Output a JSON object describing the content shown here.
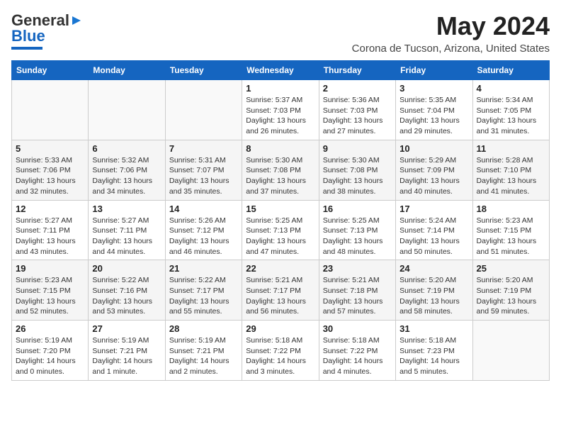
{
  "logo": {
    "line1": "General",
    "line2": "Blue"
  },
  "title": "May 2024",
  "location": "Corona de Tucson, Arizona, United States",
  "days_header": [
    "Sunday",
    "Monday",
    "Tuesday",
    "Wednesday",
    "Thursday",
    "Friday",
    "Saturday"
  ],
  "weeks": [
    [
      {
        "day": "",
        "info": ""
      },
      {
        "day": "",
        "info": ""
      },
      {
        "day": "",
        "info": ""
      },
      {
        "day": "1",
        "info": "Sunrise: 5:37 AM\nSunset: 7:03 PM\nDaylight: 13 hours\nand 26 minutes."
      },
      {
        "day": "2",
        "info": "Sunrise: 5:36 AM\nSunset: 7:03 PM\nDaylight: 13 hours\nand 27 minutes."
      },
      {
        "day": "3",
        "info": "Sunrise: 5:35 AM\nSunset: 7:04 PM\nDaylight: 13 hours\nand 29 minutes."
      },
      {
        "day": "4",
        "info": "Sunrise: 5:34 AM\nSunset: 7:05 PM\nDaylight: 13 hours\nand 31 minutes."
      }
    ],
    [
      {
        "day": "5",
        "info": "Sunrise: 5:33 AM\nSunset: 7:06 PM\nDaylight: 13 hours\nand 32 minutes."
      },
      {
        "day": "6",
        "info": "Sunrise: 5:32 AM\nSunset: 7:06 PM\nDaylight: 13 hours\nand 34 minutes."
      },
      {
        "day": "7",
        "info": "Sunrise: 5:31 AM\nSunset: 7:07 PM\nDaylight: 13 hours\nand 35 minutes."
      },
      {
        "day": "8",
        "info": "Sunrise: 5:30 AM\nSunset: 7:08 PM\nDaylight: 13 hours\nand 37 minutes."
      },
      {
        "day": "9",
        "info": "Sunrise: 5:30 AM\nSunset: 7:08 PM\nDaylight: 13 hours\nand 38 minutes."
      },
      {
        "day": "10",
        "info": "Sunrise: 5:29 AM\nSunset: 7:09 PM\nDaylight: 13 hours\nand 40 minutes."
      },
      {
        "day": "11",
        "info": "Sunrise: 5:28 AM\nSunset: 7:10 PM\nDaylight: 13 hours\nand 41 minutes."
      }
    ],
    [
      {
        "day": "12",
        "info": "Sunrise: 5:27 AM\nSunset: 7:11 PM\nDaylight: 13 hours\nand 43 minutes."
      },
      {
        "day": "13",
        "info": "Sunrise: 5:27 AM\nSunset: 7:11 PM\nDaylight: 13 hours\nand 44 minutes."
      },
      {
        "day": "14",
        "info": "Sunrise: 5:26 AM\nSunset: 7:12 PM\nDaylight: 13 hours\nand 46 minutes."
      },
      {
        "day": "15",
        "info": "Sunrise: 5:25 AM\nSunset: 7:13 PM\nDaylight: 13 hours\nand 47 minutes."
      },
      {
        "day": "16",
        "info": "Sunrise: 5:25 AM\nSunset: 7:13 PM\nDaylight: 13 hours\nand 48 minutes."
      },
      {
        "day": "17",
        "info": "Sunrise: 5:24 AM\nSunset: 7:14 PM\nDaylight: 13 hours\nand 50 minutes."
      },
      {
        "day": "18",
        "info": "Sunrise: 5:23 AM\nSunset: 7:15 PM\nDaylight: 13 hours\nand 51 minutes."
      }
    ],
    [
      {
        "day": "19",
        "info": "Sunrise: 5:23 AM\nSunset: 7:15 PM\nDaylight: 13 hours\nand 52 minutes."
      },
      {
        "day": "20",
        "info": "Sunrise: 5:22 AM\nSunset: 7:16 PM\nDaylight: 13 hours\nand 53 minutes."
      },
      {
        "day": "21",
        "info": "Sunrise: 5:22 AM\nSunset: 7:17 PM\nDaylight: 13 hours\nand 55 minutes."
      },
      {
        "day": "22",
        "info": "Sunrise: 5:21 AM\nSunset: 7:17 PM\nDaylight: 13 hours\nand 56 minutes."
      },
      {
        "day": "23",
        "info": "Sunrise: 5:21 AM\nSunset: 7:18 PM\nDaylight: 13 hours\nand 57 minutes."
      },
      {
        "day": "24",
        "info": "Sunrise: 5:20 AM\nSunset: 7:19 PM\nDaylight: 13 hours\nand 58 minutes."
      },
      {
        "day": "25",
        "info": "Sunrise: 5:20 AM\nSunset: 7:19 PM\nDaylight: 13 hours\nand 59 minutes."
      }
    ],
    [
      {
        "day": "26",
        "info": "Sunrise: 5:19 AM\nSunset: 7:20 PM\nDaylight: 14 hours\nand 0 minutes."
      },
      {
        "day": "27",
        "info": "Sunrise: 5:19 AM\nSunset: 7:21 PM\nDaylight: 14 hours\nand 1 minute."
      },
      {
        "day": "28",
        "info": "Sunrise: 5:19 AM\nSunset: 7:21 PM\nDaylight: 14 hours\nand 2 minutes."
      },
      {
        "day": "29",
        "info": "Sunrise: 5:18 AM\nSunset: 7:22 PM\nDaylight: 14 hours\nand 3 minutes."
      },
      {
        "day": "30",
        "info": "Sunrise: 5:18 AM\nSunset: 7:22 PM\nDaylight: 14 hours\nand 4 minutes."
      },
      {
        "day": "31",
        "info": "Sunrise: 5:18 AM\nSunset: 7:23 PM\nDaylight: 14 hours\nand 5 minutes."
      },
      {
        "day": "",
        "info": ""
      }
    ]
  ]
}
